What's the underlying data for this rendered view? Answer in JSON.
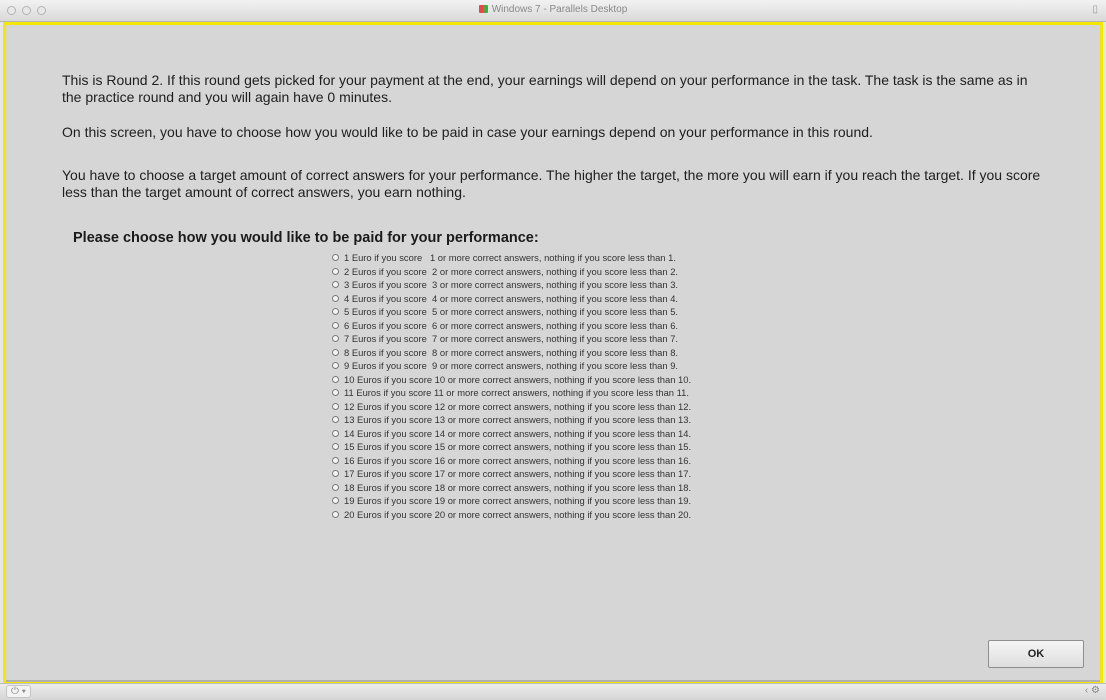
{
  "window": {
    "title": "Windows 7 - Parallels Desktop",
    "corner_icon": "parallels-icon"
  },
  "instructions": {
    "para1": "This is Round 2. If this round gets picked for your payment at the end, your earnings will depend on your performance in the task. The task is the same as in the practice round and you will again have 0 minutes.",
    "para2": "On this screen, you have to choose how you would like to be paid in case your earnings depend on your performance in this round.",
    "para3": "You have to choose a target amount of correct answers for your performance. The higher the target, the more you will earn if you reach the target. If you score less than the target amount of correct answers, you earn nothing.",
    "heading": "Please choose how you would like to be paid for your performance:"
  },
  "options": [
    "1 Euro if you score   1 or more correct answers, nothing if you score less than 1.",
    "2 Euros if you score  2 or more correct answers, nothing if you score less than 2.",
    "3 Euros if you score  3 or more correct answers, nothing if you score less than 3.",
    "4 Euros if you score  4 or more correct answers, nothing if you score less than 4.",
    "5 Euros if you score  5 or more correct answers, nothing if you score less than 5.",
    "6 Euros if you score  6 or more correct answers, nothing if you score less than 6.",
    "7 Euros if you score  7 or more correct answers, nothing if you score less than 7.",
    "8 Euros if you score  8 or more correct answers, nothing if you score less than 8.",
    "9 Euros if you score  9 or more correct answers, nothing if you score less than 9.",
    "10 Euros if you score 10 or more correct answers, nothing if you score less than 10.",
    "11 Euros if you score 11 or more correct answers, nothing if you score less than 11.",
    "12 Euros if you score 12 or more correct answers, nothing if you score less than 12.",
    "13 Euros if you score 13 or more correct answers, nothing if you score less than 13.",
    "14 Euros if you score 14 or more correct answers, nothing if you score less than 14.",
    "15 Euros if you score 15 or more correct answers, nothing if you score less than 15.",
    "16 Euros if you score 16 or more correct answers, nothing if you score less than 16.",
    "17 Euros if you score 17 or more correct answers, nothing if you score less than 17.",
    "18 Euros if you score 18 or more correct answers, nothing if you score less than 18.",
    "19 Euros if you score 19 or more correct answers, nothing if you score less than 19.",
    "20 Euros if you score 20 or more correct answers, nothing if you score less than 20."
  ],
  "buttons": {
    "ok": "OK"
  },
  "statusbar": {
    "left_icon": "power-icon",
    "right_icon": "settings-icon"
  },
  "colors": {
    "frame": "#f2e800",
    "background": "#d6d6d6"
  }
}
